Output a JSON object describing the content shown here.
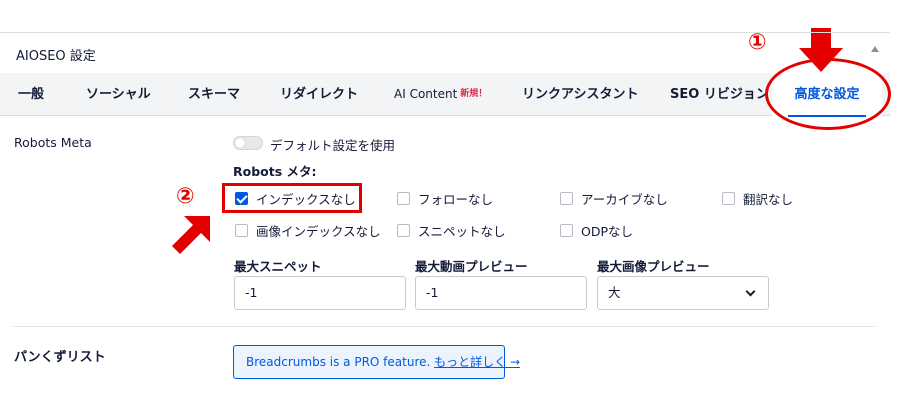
{
  "panel": {
    "title": "AIOSEO 設定"
  },
  "tabs": [
    {
      "label": "一般"
    },
    {
      "label": "ソーシャル"
    },
    {
      "label": "スキーマ"
    },
    {
      "label": "リダイレクト"
    },
    {
      "label": "AI Content",
      "badge": "新規！"
    },
    {
      "label": "リンクアシスタント"
    },
    {
      "label": "SEO リビジョン"
    },
    {
      "label": "高度な設定",
      "active": true
    }
  ],
  "robots_meta": {
    "row_label": "Robots Meta",
    "default_toggle_label": "デフォルト設定を使用",
    "robots_title": "Robots メタ:",
    "checkboxes": [
      {
        "label": "インデックスなし",
        "checked": true
      },
      {
        "label": "フォローなし",
        "checked": false
      },
      {
        "label": "アーカイブなし",
        "checked": false
      },
      {
        "label": "翻訳なし",
        "checked": false
      },
      {
        "label": "画像インデックスなし",
        "checked": false
      },
      {
        "label": "スニペットなし",
        "checked": false
      },
      {
        "label": "ODPなし",
        "checked": false
      }
    ],
    "fields": [
      {
        "label": "最大スニペット",
        "value": "-1"
      },
      {
        "label": "最大動画プレビュー",
        "value": "-1"
      },
      {
        "label": "最大画像プレビュー",
        "value": "大"
      }
    ]
  },
  "breadcrumbs": {
    "row_label": "パンくずリスト",
    "notice_text": "Breadcrumbs is a PRO feature. ",
    "notice_link": "もっと詳しく →"
  },
  "annotations": {
    "marker_1": "①",
    "marker_2": "②",
    "annotation_color": "#e50000"
  },
  "colors": {
    "accent": "#005ae0",
    "text": "#141b38",
    "badge": "#df2a4a"
  }
}
